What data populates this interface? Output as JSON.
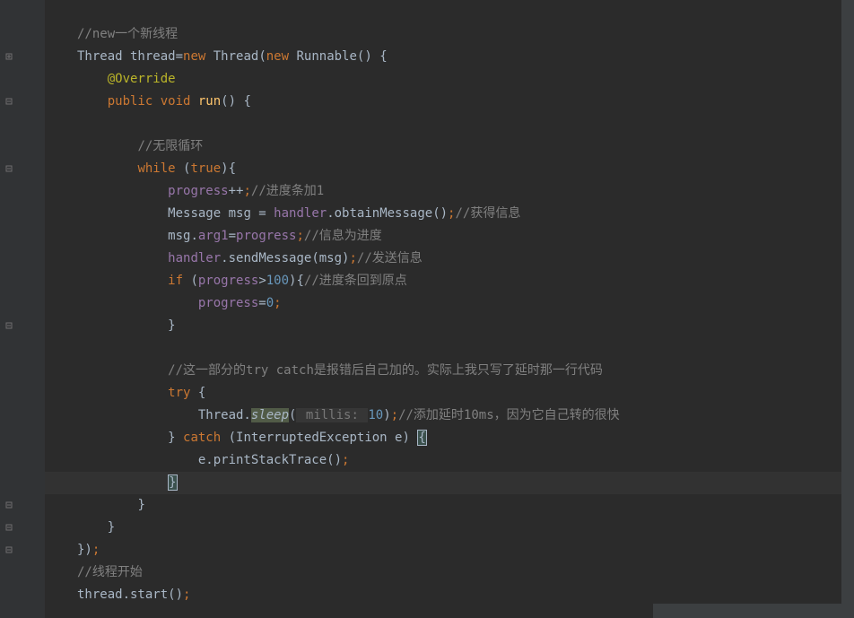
{
  "code": {
    "l1_comment": "//new一个新线程",
    "l2_a": "Thread thread=",
    "l2_new1": "new",
    "l2_b": " Thread(",
    "l2_new2": "new",
    "l2_c": " Runnable() {",
    "l3_anno": "@Override",
    "l4_public": "public",
    "l4_void": " void",
    "l4_run": " run",
    "l4_rest": "() {",
    "l6_comment": "//无限循环",
    "l7_while": "while",
    "l7_a": " (",
    "l7_true": "true",
    "l7_b": "){",
    "l8_var": "progress",
    "l8_op": "++",
    "l8_semi": ";",
    "l8_comment": "//进度条加1",
    "l9_a": "Message msg = ",
    "l9_handler": "handler",
    "l9_b": ".obtainMessage()",
    "l9_semi": ";",
    "l9_comment": "//获得信息",
    "l10_a": "msg.",
    "l10_arg1": "arg1",
    "l10_eq": "=",
    "l10_prog": "progress",
    "l10_semi": ";",
    "l10_comment": "//信息为进度",
    "l11_handler": "handler",
    "l11_b": ".sendMessage(msg)",
    "l11_semi": ";",
    "l11_comment": "//发送信息",
    "l12_if": "if",
    "l12_a": " (",
    "l12_prog": "progress",
    "l12_b": ">",
    "l12_num": "100",
    "l12_c": "){",
    "l12_comment": "//进度条回到原点",
    "l13_prog": "progress",
    "l13_eq": "=",
    "l13_zero": "0",
    "l13_semi": ";",
    "l14_close": "}",
    "l16_comment": "//这一部分的try catch是报错后自己加的。实际上我只写了延时那一行代码",
    "l17_try": "try",
    "l17_brace": " {",
    "l18_a": "Thread.",
    "l18_sleep": "sleep",
    "l18_paren": "(",
    "l18_hint": " millis: ",
    "l18_num": "10",
    "l18_close": ")",
    "l18_semi": ";",
    "l18_comment": "//添加延时10ms，因为它自己转的很快",
    "l19_close": "} ",
    "l19_catch": "catch",
    "l19_a": " (InterruptedException e) ",
    "l19_brace": "{",
    "l20_a": "e.printStackTrace()",
    "l20_semi": ";",
    "l21_brace": "}",
    "l22_brace": "}",
    "l23_brace": "}",
    "l24_a": "})",
    "l24_semi": ";",
    "l25_comment": "//线程开始",
    "l26_a": "thread.start()",
    "l26_semi": ";"
  },
  "gutter_icons": [
    "collapse",
    "collapse",
    "collapse",
    "collapse",
    "collapse",
    "collapse",
    "collapse"
  ]
}
